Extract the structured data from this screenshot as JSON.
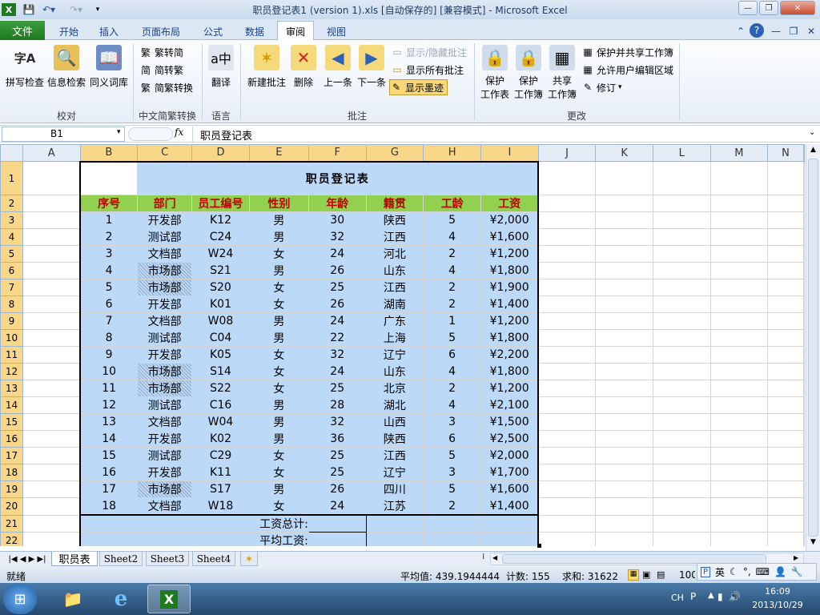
{
  "window": {
    "title": "职员登记表1 (version 1).xls [自动保存的]  [兼容模式] - Microsoft Excel"
  },
  "tabs": [
    "文件",
    "开始",
    "插入",
    "页面布局",
    "公式",
    "数据",
    "审阅",
    "视图"
  ],
  "ribbon": {
    "proofing": {
      "spell": "拼写检查",
      "research": "信息检索",
      "thesaurus": "同义词库",
      "label": "校对"
    },
    "chinese": {
      "t2s": "繁转简",
      "s2t": "简转繁",
      "convert": "简繁转换",
      "label": "中文简繁转换"
    },
    "language": {
      "translate": "翻译",
      "label": "语言"
    },
    "comments": {
      "new": "新建批注",
      "delete": "删除",
      "prev": "上一条",
      "next": "下一条",
      "show_hide": "显示/隐藏批注",
      "show_all": "显示所有批注",
      "show_ink": "显示墨迹",
      "label": "批注"
    },
    "changes": {
      "protect_sheet_1": "保护",
      "protect_sheet_2": "工作表",
      "protect_wb_1": "保护",
      "protect_wb_2": "工作簿",
      "share_1": "共享",
      "share_2": "工作簿",
      "protect_share": "保护并共享工作簿",
      "allow_edit": "允许用户编辑区域",
      "track": "修订",
      "label": "更改"
    }
  },
  "formula_bar": {
    "name_box": "B1",
    "fx": "fx",
    "content": "职员登记表"
  },
  "columns": [
    "A",
    "B",
    "C",
    "D",
    "E",
    "F",
    "G",
    "H",
    "I",
    "J",
    "K",
    "L",
    "M",
    "N"
  ],
  "table": {
    "title": "职员登记表",
    "headers": [
      "序号",
      "部门",
      "员工编号",
      "性别",
      "年龄",
      "籍贯",
      "工龄",
      "工资"
    ],
    "rows": [
      [
        "1",
        "开发部",
        "K12",
        "男",
        "30",
        "陕西",
        "5",
        "¥2,000"
      ],
      [
        "2",
        "测试部",
        "C24",
        "男",
        "32",
        "江西",
        "4",
        "¥1,600"
      ],
      [
        "3",
        "文档部",
        "W24",
        "女",
        "24",
        "河北",
        "2",
        "¥1,200"
      ],
      [
        "4",
        "市场部",
        "S21",
        "男",
        "26",
        "山东",
        "4",
        "¥1,800"
      ],
      [
        "5",
        "市场部",
        "S20",
        "女",
        "25",
        "江西",
        "2",
        "¥1,900"
      ],
      [
        "6",
        "开发部",
        "K01",
        "女",
        "26",
        "湖南",
        "2",
        "¥1,400"
      ],
      [
        "7",
        "文档部",
        "W08",
        "男",
        "24",
        "广东",
        "1",
        "¥1,200"
      ],
      [
        "8",
        "测试部",
        "C04",
        "男",
        "22",
        "上海",
        "5",
        "¥1,800"
      ],
      [
        "9",
        "开发部",
        "K05",
        "女",
        "32",
        "辽宁",
        "6",
        "¥2,200"
      ],
      [
        "10",
        "市场部",
        "S14",
        "女",
        "24",
        "山东",
        "4",
        "¥1,800"
      ],
      [
        "11",
        "市场部",
        "S22",
        "女",
        "25",
        "北京",
        "2",
        "¥1,200"
      ],
      [
        "12",
        "测试部",
        "C16",
        "男",
        "28",
        "湖北",
        "4",
        "¥2,100"
      ],
      [
        "13",
        "文档部",
        "W04",
        "男",
        "32",
        "山西",
        "3",
        "¥1,500"
      ],
      [
        "14",
        "开发部",
        "K02",
        "男",
        "36",
        "陕西",
        "6",
        "¥2,500"
      ],
      [
        "15",
        "测试部",
        "C29",
        "女",
        "25",
        "江西",
        "5",
        "¥2,000"
      ],
      [
        "16",
        "开发部",
        "K11",
        "女",
        "25",
        "辽宁",
        "3",
        "¥1,700"
      ],
      [
        "17",
        "市场部",
        "S17",
        "男",
        "26",
        "四川",
        "5",
        "¥1,600"
      ],
      [
        "18",
        "文档部",
        "W18",
        "女",
        "24",
        "江苏",
        "2",
        "¥1,400"
      ]
    ],
    "total_label": "工资总计:",
    "avg_label": "平均工资:"
  },
  "sheets": [
    "职员表",
    "Sheet2",
    "Sheet3",
    "Sheet4"
  ],
  "status": {
    "ready": "就绪",
    "average": "平均值: 439.1944444",
    "count": "计数: 155",
    "sum": "求和: 31622",
    "zoom": "100"
  },
  "ime": {
    "mode": "英"
  },
  "taskbar": {
    "lang": "CH",
    "time": "16:09",
    "date": "2013/10/29"
  }
}
